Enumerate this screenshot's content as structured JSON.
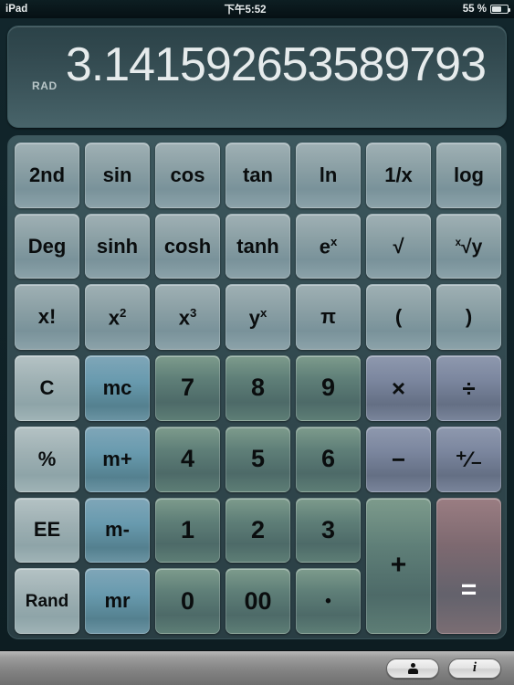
{
  "statusbar": {
    "device": "iPad",
    "time": "下午5:52",
    "battery_percent": "55 %",
    "battery_icon": "battery-icon"
  },
  "display": {
    "value": "3.141592653589793",
    "angle_mode": "RAD"
  },
  "keypad": {
    "columns": 7,
    "rows": 7,
    "keys": [
      {
        "label": "2nd",
        "name": "key-second",
        "kind": "fn",
        "col": 0,
        "row": 0
      },
      {
        "label": "sin",
        "name": "key-sin",
        "kind": "fn",
        "col": 1,
        "row": 0
      },
      {
        "label": "cos",
        "name": "key-cos",
        "kind": "fn",
        "col": 2,
        "row": 0
      },
      {
        "label": "tan",
        "name": "key-tan",
        "kind": "fn",
        "col": 3,
        "row": 0
      },
      {
        "label": "ln",
        "name": "key-ln",
        "kind": "fn",
        "col": 4,
        "row": 0
      },
      {
        "label": "1/x",
        "name": "key-reciprocal",
        "kind": "fn",
        "col": 5,
        "row": 0
      },
      {
        "label": "log",
        "name": "key-log",
        "kind": "fn",
        "col": 6,
        "row": 0
      },
      {
        "label": "Deg",
        "name": "key-deg",
        "kind": "fn",
        "col": 0,
        "row": 1
      },
      {
        "label": "sinh",
        "name": "key-sinh",
        "kind": "fn",
        "col": 1,
        "row": 1
      },
      {
        "label": "cosh",
        "name": "key-cosh",
        "kind": "fn",
        "col": 2,
        "row": 1
      },
      {
        "label": "tanh",
        "name": "key-tanh",
        "kind": "fn",
        "col": 3,
        "row": 1
      },
      {
        "label": "e^x",
        "name": "key-e-power-x",
        "kind": "fn",
        "col": 4,
        "row": 1,
        "html": "e<sup>x</sup>"
      },
      {
        "label": "√",
        "name": "key-sqrt",
        "kind": "fn",
        "col": 5,
        "row": 1
      },
      {
        "label": "x√y",
        "name": "key-nth-root",
        "kind": "fn",
        "col": 6,
        "row": 1,
        "html": "<span class='nth'><span class='idx'>x</span>√y</span>"
      },
      {
        "label": "x!",
        "name": "key-factorial",
        "kind": "fn",
        "col": 0,
        "row": 2
      },
      {
        "label": "x^2",
        "name": "key-x-squared",
        "kind": "fn",
        "col": 1,
        "row": 2,
        "html": "x<sup>2</sup>"
      },
      {
        "label": "x^3",
        "name": "key-x-cubed",
        "kind": "fn",
        "col": 2,
        "row": 2,
        "html": "x<sup>3</sup>"
      },
      {
        "label": "y^x",
        "name": "key-y-power-x",
        "kind": "fn",
        "col": 3,
        "row": 2,
        "html": "y<sup>x</sup>"
      },
      {
        "label": "π",
        "name": "key-pi",
        "kind": "fn",
        "col": 4,
        "row": 2
      },
      {
        "label": "(",
        "name": "key-open-paren",
        "kind": "fn",
        "col": 5,
        "row": 2
      },
      {
        "label": ")",
        "name": "key-close-paren",
        "kind": "fn",
        "col": 6,
        "row": 2
      },
      {
        "label": "C",
        "name": "key-clear",
        "kind": "clear",
        "col": 0,
        "row": 3
      },
      {
        "label": "mc",
        "name": "key-memory-clear",
        "kind": "mem",
        "col": 1,
        "row": 3
      },
      {
        "label": "7",
        "name": "key-7",
        "kind": "digit",
        "col": 2,
        "row": 3
      },
      {
        "label": "8",
        "name": "key-8",
        "kind": "digit",
        "col": 3,
        "row": 3
      },
      {
        "label": "9",
        "name": "key-9",
        "kind": "digit",
        "col": 4,
        "row": 3
      },
      {
        "label": "×",
        "name": "key-multiply",
        "kind": "op",
        "col": 5,
        "row": 3
      },
      {
        "label": "÷",
        "name": "key-divide",
        "kind": "op",
        "col": 6,
        "row": 3
      },
      {
        "label": "%",
        "name": "key-percent",
        "kind": "clear",
        "col": 0,
        "row": 4
      },
      {
        "label": "m+",
        "name": "key-memory-add",
        "kind": "mem",
        "col": 1,
        "row": 4
      },
      {
        "label": "4",
        "name": "key-4",
        "kind": "digit",
        "col": 2,
        "row": 4
      },
      {
        "label": "5",
        "name": "key-5",
        "kind": "digit",
        "col": 3,
        "row": 4
      },
      {
        "label": "6",
        "name": "key-6",
        "kind": "digit",
        "col": 4,
        "row": 4
      },
      {
        "label": "−",
        "name": "key-subtract",
        "kind": "op",
        "col": 5,
        "row": 4
      },
      {
        "label": "+/−",
        "name": "key-sign-toggle",
        "kind": "op",
        "col": 6,
        "row": 4,
        "html": "<span style='font-size:24px'>⁺∕₋</span>"
      },
      {
        "label": "EE",
        "name": "key-ee",
        "kind": "clear",
        "col": 0,
        "row": 5
      },
      {
        "label": "m-",
        "name": "key-memory-sub",
        "kind": "mem",
        "col": 1,
        "row": 5
      },
      {
        "label": "1",
        "name": "key-1",
        "kind": "digit",
        "col": 2,
        "row": 5
      },
      {
        "label": "2",
        "name": "key-2",
        "kind": "digit",
        "col": 3,
        "row": 5
      },
      {
        "label": "3",
        "name": "key-3",
        "kind": "digit",
        "col": 4,
        "row": 5
      },
      {
        "label": "+",
        "name": "key-add",
        "kind": "plus",
        "col": 5,
        "row": 5,
        "rowspan": 2
      },
      {
        "label": "=",
        "name": "key-equals",
        "kind": "eq",
        "col": 6,
        "row": 5,
        "rowspan": 2
      },
      {
        "label": "Rand",
        "name": "key-random",
        "kind": "clear",
        "col": 0,
        "row": 6,
        "small": true
      },
      {
        "label": "mr",
        "name": "key-memory-recall",
        "kind": "mem",
        "col": 1,
        "row": 6
      },
      {
        "label": "0",
        "name": "key-0",
        "kind": "digit",
        "col": 2,
        "row": 6
      },
      {
        "label": "00",
        "name": "key-double-zero",
        "kind": "digit",
        "col": 3,
        "row": 6
      },
      {
        "label": "•",
        "name": "key-decimal-point",
        "kind": "digit",
        "col": 4,
        "row": 6,
        "small": true
      }
    ]
  },
  "toolbar": {
    "buttons": [
      {
        "name": "contact-button",
        "icon": "person-icon",
        "label": ""
      },
      {
        "name": "info-button",
        "icon": "info-icon",
        "label": "i"
      }
    ]
  },
  "colors": {
    "panel_bg": "#32494f",
    "display_bg": "#3b545a",
    "function_key": "#8ba0a5",
    "memory_key": "#689aae",
    "digit_key": "#5f7f78",
    "operator_key": "#7b869e",
    "equals_key": "#7d6970",
    "display_text": "#e6ebec"
  }
}
